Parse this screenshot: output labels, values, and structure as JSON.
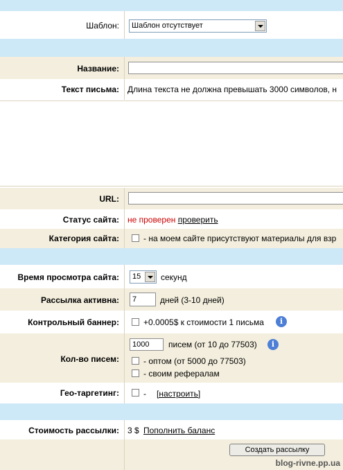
{
  "template": {
    "label": "Шаблон:",
    "selected": "Шаблон отсутствует"
  },
  "title": {
    "label": "Название:",
    "value": ""
  },
  "text": {
    "label": "Текст письма:",
    "hint": "Длина текста не должна превышать 3000 символов, н"
  },
  "url": {
    "label": "URL:",
    "value": ""
  },
  "status": {
    "label": "Статус сайта:",
    "value": "не проверен",
    "check_link": "проверить"
  },
  "category": {
    "label": "Категория сайта:",
    "text": "- на моем сайте присутствуют материалы для взр"
  },
  "view_time": {
    "label": "Время просмотра сайта:",
    "selected": "15",
    "unit": "секунд"
  },
  "active": {
    "label": "Рассылка активна:",
    "value": "7",
    "unit": "дней (3-10 дней)"
  },
  "banner": {
    "label": "Контрольный баннер:",
    "text": "+0.0005$ к стоимости 1 письма"
  },
  "count": {
    "label": "Кол-во писем:",
    "value": "1000",
    "range": "писем (от 10 до 77503)",
    "wholesale": "- оптом (от 5000 до 77503)",
    "referrals": "- своим рефералам"
  },
  "geo": {
    "label": "Гео-таргетинг:",
    "dash": "-",
    "link": "[настроить]"
  },
  "cost": {
    "label": "Стоимость рассылки:",
    "value": "3 $",
    "link": "Пополнить баланс"
  },
  "submit": {
    "label": "Создать рассылку"
  },
  "watermark": "blog-rivne.pp.ua",
  "colors": {
    "separator": "#cde8f7",
    "label_bg": "#f3eedd",
    "status_red": "#cc0000",
    "info_icon": "#4d7fd6"
  }
}
